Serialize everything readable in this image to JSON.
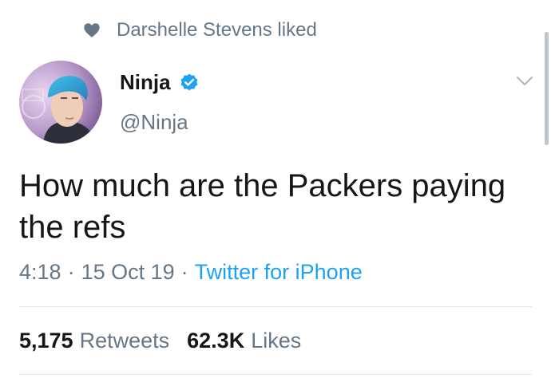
{
  "social_context": {
    "icon": "heart-icon",
    "text": "Darshelle Stevens liked"
  },
  "author": {
    "name": "Ninja",
    "handle": "@Ninja",
    "verified": true,
    "verified_color": "#1da1f2"
  },
  "tweet": {
    "text": "How much are the Packers paying the refs"
  },
  "meta": {
    "time": "4:18",
    "separator": "·",
    "date": "15 Oct 19",
    "source": "Twitter for iPhone"
  },
  "stats": {
    "retweets_count": "5,175",
    "retweets_label": "Retweets",
    "likes_count": "62.3K",
    "likes_label": "Likes"
  },
  "colors": {
    "text": "#14171a",
    "secondary": "#657786",
    "accent": "#1da1f2",
    "divider": "#e1e8ed"
  }
}
